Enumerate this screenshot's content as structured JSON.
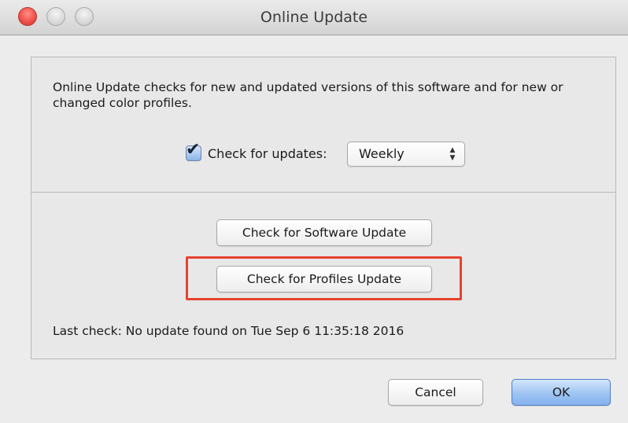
{
  "window": {
    "title": "Online Update",
    "traffic_lights": [
      "close",
      "minimize",
      "zoom"
    ]
  },
  "settings": {
    "description": "Online Update checks for new and updated versions of this software and for new or changed color profiles.",
    "check_mark": "✔",
    "auto_check_label": "Check for updates:",
    "auto_check_checked": true,
    "frequency": {
      "selected": "Weekly",
      "arrows": "▲\n▼"
    }
  },
  "actions": {
    "software_update_label": "Check for Software Update",
    "profiles_update_label": "Check for Profiles Update",
    "last_check": "Last check:  No update found on Tue Sep  6 11:35:18 2016"
  },
  "footer": {
    "cancel_label": "Cancel",
    "ok_label": "OK"
  },
  "colors": {
    "highlight": "#e5432f",
    "close_red": "#f0524a",
    "default_button_blue": "#84b1ee"
  }
}
